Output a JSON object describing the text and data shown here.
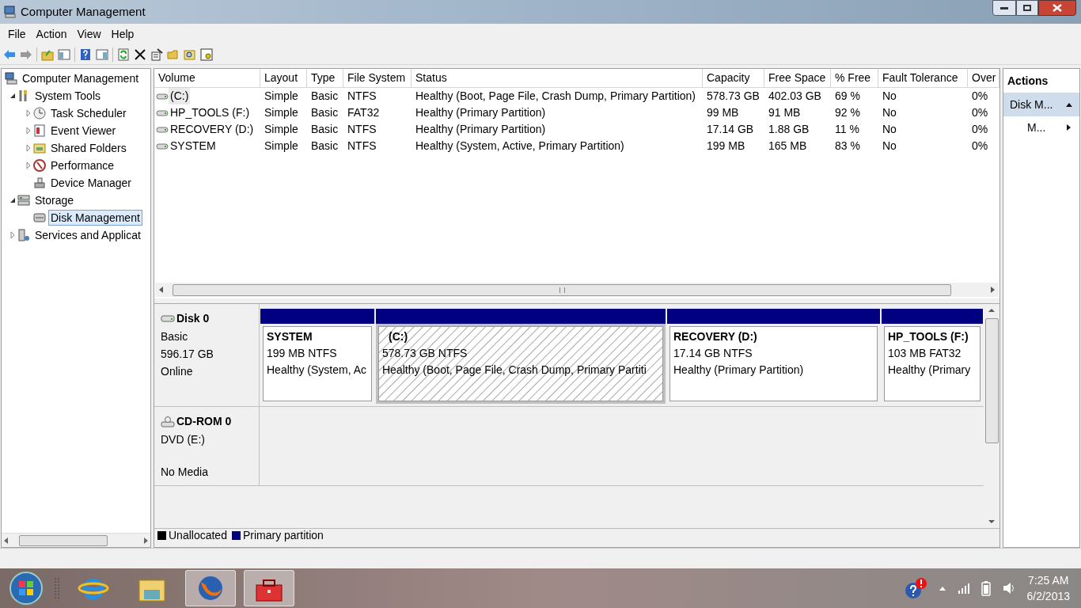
{
  "window": {
    "title": "Computer Management"
  },
  "menu": [
    {
      "label": "File"
    },
    {
      "label": "Action"
    },
    {
      "label": "View"
    },
    {
      "label": "Help"
    }
  ],
  "tree": [
    {
      "label": "Computer Management",
      "selected": false,
      "children": [
        {
          "label": "System Tools",
          "expanded": true,
          "selected": false,
          "children": [
            {
              "label": "Task Scheduler",
              "expanded": false,
              "selected": false
            },
            {
              "label": "Event Viewer",
              "expanded": false,
              "selected": false
            },
            {
              "label": "Shared Folders",
              "expanded": false,
              "selected": false
            },
            {
              "label": "Performance",
              "expanded": false,
              "selected": false
            },
            {
              "label": "Device Manager",
              "selected": false
            }
          ]
        },
        {
          "label": "Storage",
          "expanded": true,
          "selected": false,
          "children": [
            {
              "label": "Disk Management",
              "selected": true
            }
          ]
        },
        {
          "label": "Services and Applicat",
          "expanded": false,
          "selected": false
        }
      ]
    }
  ],
  "volumes": {
    "columns": [
      "Volume",
      "Layout",
      "Type",
      "File System",
      "Status",
      "Capacity",
      "Free Space",
      "% Free",
      "Fault Tolerance",
      "Over"
    ],
    "rows": [
      {
        "selected": true,
        "cells": [
          "(C:)",
          "Simple",
          "Basic",
          "NTFS",
          "Healthy (Boot, Page File, Crash Dump, Primary Partition)",
          "578.73 GB",
          "402.03 GB",
          "69 %",
          "No",
          "0%"
        ]
      },
      {
        "selected": false,
        "cells": [
          "HP_TOOLS (F:)",
          "Simple",
          "Basic",
          "FAT32",
          "Healthy (Primary Partition)",
          "99 MB",
          "91 MB",
          "92 %",
          "No",
          "0%"
        ]
      },
      {
        "selected": false,
        "cells": [
          "RECOVERY (D:)",
          "Simple",
          "Basic",
          "NTFS",
          "Healthy (Primary Partition)",
          "17.14 GB",
          "1.88 GB",
          "11 %",
          "No",
          "0%"
        ]
      },
      {
        "selected": false,
        "cells": [
          "SYSTEM",
          "Simple",
          "Basic",
          "NTFS",
          "Healthy (System, Active, Primary Partition)",
          "199 MB",
          "165 MB",
          "83 %",
          "No",
          "0%"
        ]
      }
    ]
  },
  "disks": [
    {
      "kind": "disk",
      "name": "Disk 0",
      "type": "Basic",
      "size": "596.17 GB",
      "status": "Online",
      "partitions": [
        {
          "title": "SYSTEM",
          "size": "199 MB NTFS",
          "status": "Healthy (System, Ac",
          "selected": false
        },
        {
          "title": "(C:)",
          "size": "578.73 GB NTFS",
          "status": "Healthy (Boot, Page File, Crash Dump, Primary Partiti",
          "selected": true
        },
        {
          "title": "RECOVERY  (D:)",
          "size": "17.14 GB NTFS",
          "status": "Healthy (Primary Partition)",
          "selected": false
        },
        {
          "title": "HP_TOOLS  (F:)",
          "size": "103 MB FAT32",
          "status": "Healthy (Primary",
          "selected": false
        }
      ]
    },
    {
      "kind": "cdrom",
      "name": "CD-ROM 0",
      "type": "DVD (E:)",
      "status": "No Media"
    }
  ],
  "legend": [
    {
      "label": "Unallocated",
      "color": "#000000"
    },
    {
      "label": "Primary partition",
      "color": "#000080"
    }
  ],
  "actions": {
    "title": "Actions",
    "items": [
      {
        "label": "Disk M...",
        "kind": "section"
      },
      {
        "label": "M...",
        "kind": "submenu"
      }
    ]
  },
  "taskbar": {
    "time": "7:25 AM",
    "date": "6/2/2013"
  }
}
